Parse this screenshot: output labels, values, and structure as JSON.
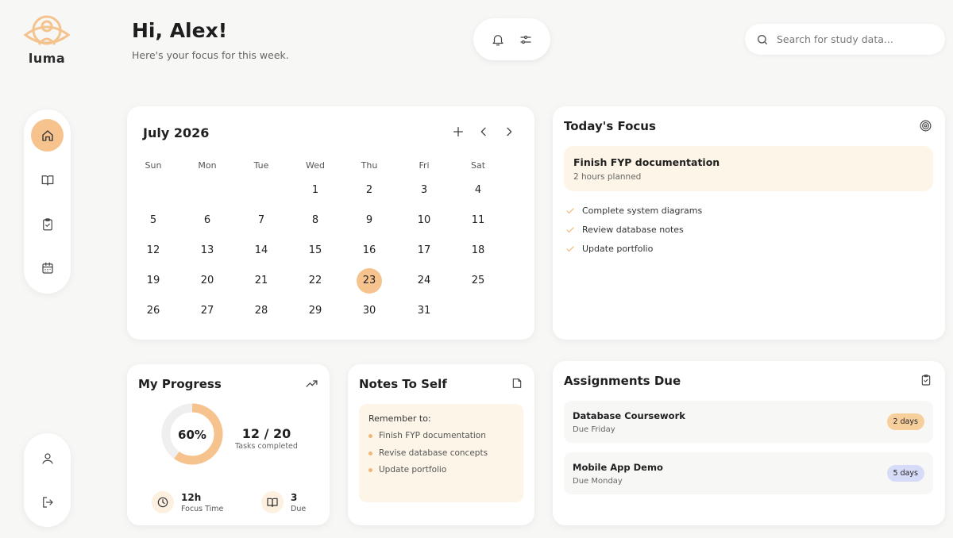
{
  "brand": {
    "name": "luma"
  },
  "header": {
    "greeting": "Hi, Alex!",
    "subtitle": "Here's your focus for this week.",
    "search_placeholder": "Search for study data..."
  },
  "nav": {
    "top_items": [
      {
        "icon": "home-icon",
        "active": true
      },
      {
        "icon": "book-icon",
        "active": false
      },
      {
        "icon": "clipboard-check-icon",
        "active": false
      },
      {
        "icon": "calendar-icon",
        "active": false
      }
    ],
    "bottom_items": [
      {
        "icon": "user-icon"
      },
      {
        "icon": "logout-icon"
      }
    ]
  },
  "calendar": {
    "title": "July 2026",
    "weekdays": [
      "Sun",
      "Mon",
      "Tue",
      "Wed",
      "Thu",
      "Fri",
      "Sat"
    ],
    "first_weekday_index": 3,
    "days_in_month": 31,
    "selected_day": 23
  },
  "focus": {
    "title": "Today's Focus",
    "main_task": "Finish FYP documentation",
    "main_sub": "2 hours planned",
    "items": [
      "Complete system diagrams",
      "Review database notes",
      "Update portfolio"
    ]
  },
  "progress": {
    "title": "My Progress",
    "percent": 60,
    "percent_label": "60%",
    "count": "12 / 20",
    "count_label": "Tasks completed",
    "focus_time": "12h",
    "focus_time_label": "Focus Time",
    "due_count": "3",
    "due_label": "Due"
  },
  "notes": {
    "title": "Notes To Self",
    "heading": "Remember to:",
    "items": [
      "Finish FYP documentation",
      "Revise database concepts",
      "Update portfolio"
    ]
  },
  "assignments": {
    "title": "Assignments Due",
    "items": [
      {
        "name": "Database Coursework",
        "due": "Due Friday",
        "badge": "2 days",
        "badge_color": "#f6cf9c"
      },
      {
        "name": "Mobile App Demo",
        "due": "Due Monday",
        "badge": "5 days",
        "badge_color": "#d6dcf7"
      }
    ]
  },
  "colors": {
    "accent": "#f6c38f",
    "cream": "#fdf5e7",
    "background": "#f7f7f6"
  }
}
